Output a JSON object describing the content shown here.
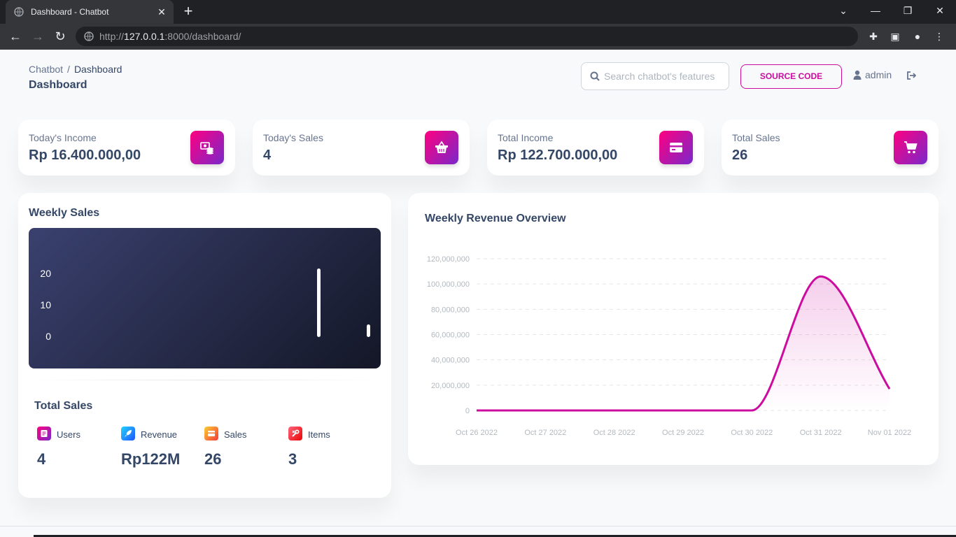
{
  "browser": {
    "tab_title": "Dashboard - Chatbot",
    "url_prefix": "http://",
    "url_host": "127.0.0.1",
    "url_rest": ":8000/dashboard/"
  },
  "header": {
    "breadcrumb_root": "Chatbot",
    "breadcrumb_separator": "/",
    "breadcrumb_current": "Dashboard",
    "title": "Dashboard",
    "search_placeholder": "Search chatbot's features",
    "source_button": "SOURCE CODE",
    "user_name": "admin"
  },
  "stats": [
    {
      "label": "Today's Income",
      "value": "Rp 16.400.000,00",
      "icon": "money-coins-icon"
    },
    {
      "label": "Today's Sales",
      "value": "4",
      "icon": "basket-icon"
    },
    {
      "label": "Total Income",
      "value": "Rp 122.700.000,00",
      "icon": "credit-card-icon"
    },
    {
      "label": "Total Sales",
      "value": "26",
      "icon": "cart-icon"
    }
  ],
  "weekly_sales": {
    "title": "Weekly Sales",
    "ticks": [
      "20",
      "10",
      "0"
    ]
  },
  "total_sales": {
    "title": "Total Sales",
    "items": [
      {
        "label": "Users",
        "value": "4",
        "icon": "document-icon",
        "color": "#cb0c9f"
      },
      {
        "label": "Revenue",
        "value": "Rp122M",
        "icon": "rocket-icon",
        "color": "#21d4fd"
      },
      {
        "label": "Sales",
        "value": "26",
        "icon": "credit-card-icon",
        "color": "#f53939"
      },
      {
        "label": "Items",
        "value": "3",
        "icon": "wrench-icon",
        "color": "#ea0606"
      }
    ]
  },
  "revenue": {
    "title": "Weekly Revenue Overview"
  },
  "chart_data": [
    {
      "type": "bar",
      "categories": [
        "",
        "",
        "",
        "",
        "",
        "",
        ""
      ],
      "values": [
        0,
        0,
        0,
        0,
        0,
        22,
        4
      ],
      "title": "Weekly Sales",
      "xlabel": "",
      "ylabel": "",
      "ylim": [
        0,
        22
      ],
      "y_ticks": [
        0,
        10,
        20
      ],
      "grid": false,
      "colors": {
        "bar": "#ffffff",
        "background_from": "#3a416f",
        "background_to": "#141727"
      }
    },
    {
      "type": "line",
      "x": [
        "Oct 26 2022",
        "Oct 27 2022",
        "Oct 28 2022",
        "Oct 29 2022",
        "Oct 30 2022",
        "Oct 31 2022",
        "Nov 01 2022"
      ],
      "series": [
        {
          "values": [
            0,
            0,
            0,
            0,
            0,
            106000000,
            17000000
          ]
        }
      ],
      "title": "Weekly Revenue Overview",
      "xlabel": "",
      "ylabel": "",
      "ylim": [
        0,
        120000000
      ],
      "y_ticks": [
        "0",
        "20,000,000",
        "40,000,000",
        "60,000,000",
        "80,000,000",
        "100,000,000",
        "120,000,000"
      ],
      "grid": true,
      "smooth": true,
      "fill": true,
      "colors": {
        "line": "#cb0c9f",
        "grid": "#e5e5e5",
        "tick_label": "#b2b9bf"
      }
    }
  ]
}
